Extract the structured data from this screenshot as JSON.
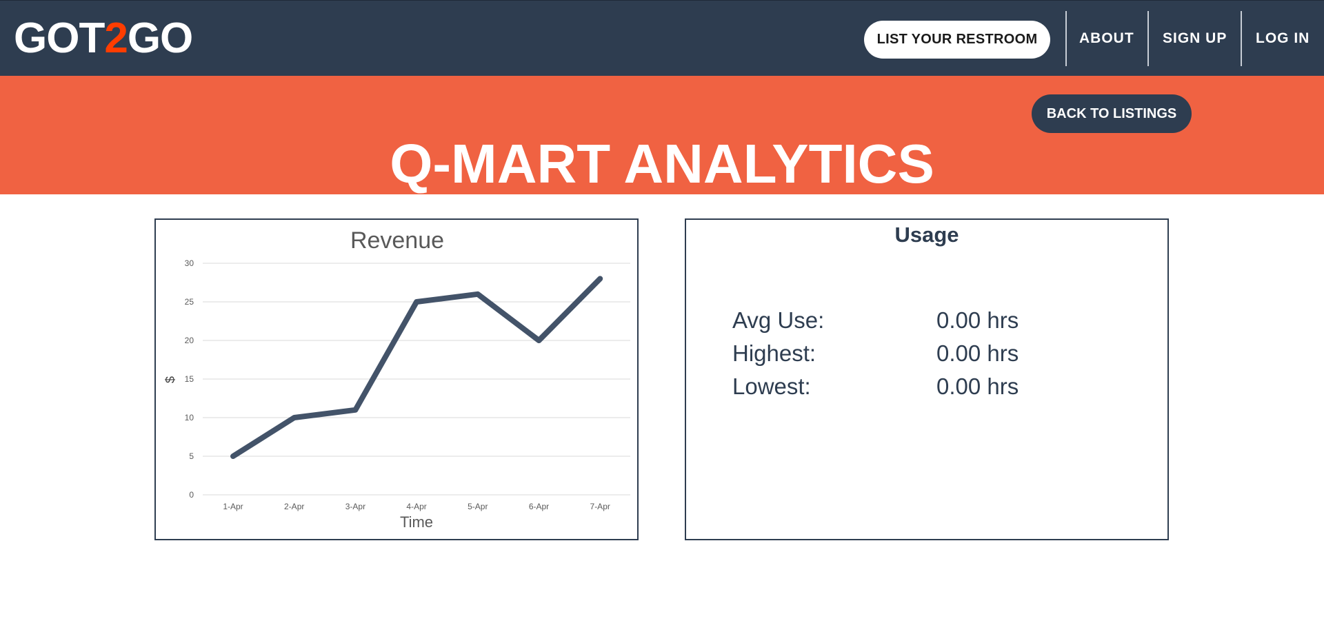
{
  "header": {
    "logo_left": "GOT",
    "logo_mid": "2",
    "logo_right": "GO",
    "list_button": "LIST YOUR RESTROOM",
    "nav": [
      "ABOUT",
      "SIGN UP",
      "LOG IN"
    ]
  },
  "banner": {
    "back_button": "BACK TO LISTINGS",
    "title": "Q-MART ANALYTICS"
  },
  "usage": {
    "title": "Usage",
    "rows": [
      {
        "label": "Avg Use:",
        "value": "0.00 hrs"
      },
      {
        "label": "Highest:",
        "value": "0.00 hrs"
      },
      {
        "label": "Lowest:",
        "value": "0.00 hrs"
      }
    ]
  },
  "colors": {
    "navy": "#2e3d50",
    "coral": "#f06242",
    "accent": "#ff3d00",
    "line": "#435369"
  },
  "chart_data": {
    "type": "line",
    "title": "Revenue",
    "xlabel": "Time",
    "ylabel": "$",
    "categories": [
      "1-Apr",
      "2-Apr",
      "3-Apr",
      "4-Apr",
      "5-Apr",
      "6-Apr",
      "7-Apr"
    ],
    "values": [
      5,
      10,
      11,
      25,
      26,
      20,
      28
    ],
    "ylim": [
      0,
      30
    ],
    "yticks": [
      0,
      5,
      10,
      15,
      20,
      25,
      30
    ],
    "grid": true
  }
}
